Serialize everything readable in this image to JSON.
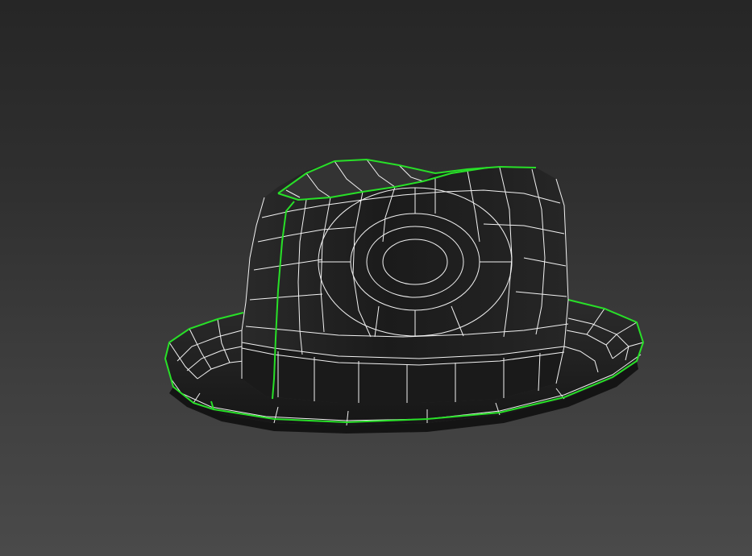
{
  "viewport": {
    "object": "hat",
    "display_mode": "edged-faces",
    "background_top": "#262626",
    "background_bottom": "#4a4a4a",
    "wire_color": "#f2f2f2",
    "selection_color": "#28e028",
    "surface_color": "#1e1e1e"
  }
}
